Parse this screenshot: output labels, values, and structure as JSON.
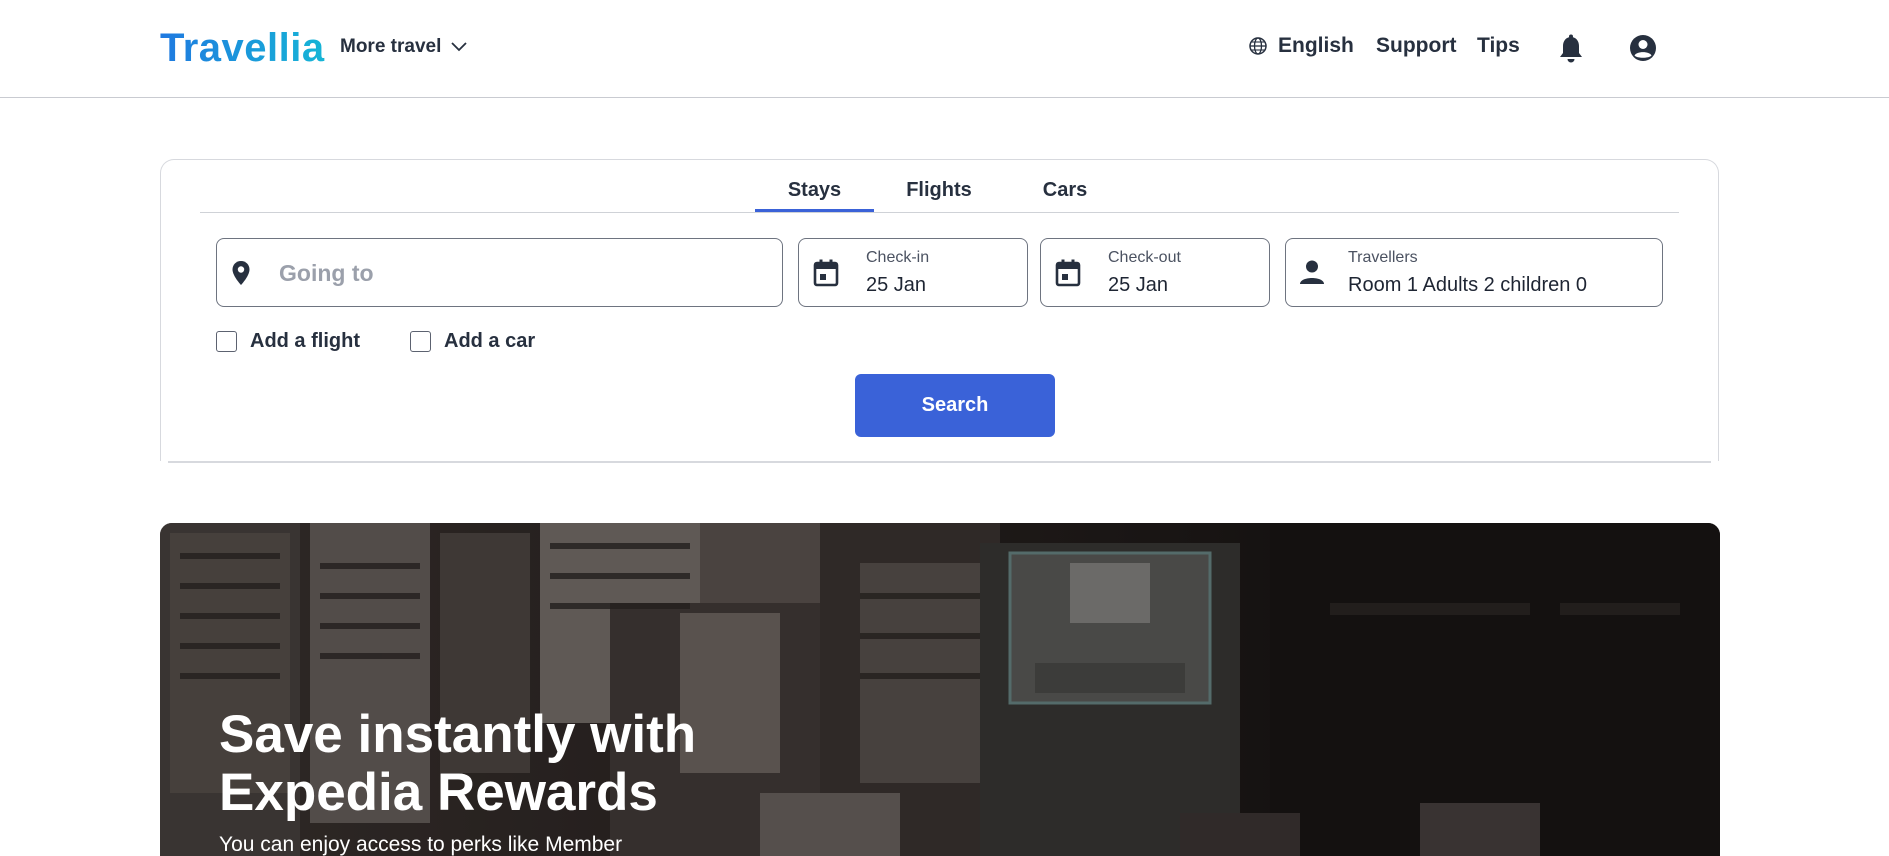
{
  "header": {
    "logo": "Travellia",
    "more_travel": "More travel",
    "language": "English",
    "support": "Support",
    "tips": "Tips"
  },
  "tabs": [
    {
      "label": "Stays",
      "active": true
    },
    {
      "label": "Flights",
      "active": false
    },
    {
      "label": "Cars",
      "active": false
    }
  ],
  "search": {
    "destination_placeholder": "Going to",
    "checkin_label": "Check-in",
    "checkin_value": "25 Jan",
    "checkout_label": "Check-out",
    "checkout_value": "25 Jan",
    "travellers_label": "Travellers",
    "travellers_value": "Room 1 Adults 2 children 0",
    "add_flight": "Add a flight",
    "add_car": "Add a car",
    "search_button": "Search"
  },
  "hero": {
    "title": "Save instantly with Expedia Rewards",
    "subtitle": "You can enjoy access to perks like Member"
  },
  "colors": {
    "accent": "#3a62d8",
    "logo_start": "#1f79e0",
    "logo_end": "#16b5d6",
    "text": "#27303f"
  }
}
